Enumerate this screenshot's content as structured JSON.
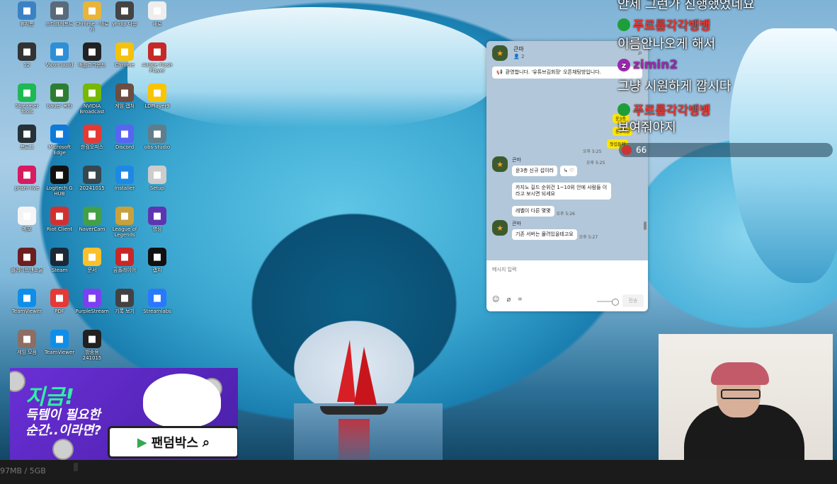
{
  "desktop": {
    "icons": [
      {
        "label": "휴지통",
        "icon": "recycle-bin-icon",
        "color": "#3b82c4"
      },
      {
        "label": "스타크래프트",
        "icon": "game-icon",
        "color": "#5a6a7a"
      },
      {
        "label": "Chrome - 바로가",
        "icon": "folder-icon",
        "color": "#e8b43a"
      },
      {
        "label": "yt-dlp 다운",
        "icon": "file-icon",
        "color": "#444"
      },
      {
        "label": "새로",
        "icon": "document-icon",
        "color": "#eee"
      },
      {
        "label": "12",
        "icon": "image-icon",
        "color": "#333"
      },
      {
        "label": "Vicon build",
        "icon": "app-icon",
        "color": "#2d8fd6"
      },
      {
        "label": "배틀그라운드",
        "icon": "pubg-icon",
        "color": "#222"
      },
      {
        "label": "Chrome",
        "icon": "chrome-icon",
        "color": "#f4c20d"
      },
      {
        "label": "Adobe Flash Player",
        "icon": "flash-icon",
        "color": "#c62828"
      },
      {
        "label": "Streamer Tools",
        "icon": "stream-icon",
        "color": "#1db954"
      },
      {
        "label": "bauer 녹화",
        "icon": "record-icon",
        "color": "#2e7d32"
      },
      {
        "label": "NVIDIA Broadcast",
        "icon": "nvidia-icon",
        "color": "#76b900"
      },
      {
        "label": "게임 캡처",
        "icon": "game-capture-icon",
        "color": "#6d4c41"
      },
      {
        "label": "LDPlayer9",
        "icon": "ldplayer-icon",
        "color": "#f9c400"
      },
      {
        "label": "프로그",
        "icon": "program-icon",
        "color": "#263238"
      },
      {
        "label": "Microsoft Edge",
        "icon": "edge-icon",
        "color": "#0f7bd8"
      },
      {
        "label": "한컴오피스",
        "icon": "hancom-icon",
        "color": "#e53935"
      },
      {
        "label": "Discord",
        "icon": "discord-icon",
        "color": "#5865f2"
      },
      {
        "label": "obs-studio",
        "icon": "obs-icon",
        "color": "#607d8b"
      },
      {
        "label": "prism live",
        "icon": "prism-icon",
        "color": "#d81b60"
      },
      {
        "label": "Logitech G HUB",
        "icon": "logitech-icon",
        "color": "#111"
      },
      {
        "label": "20241015",
        "icon": "video-icon",
        "color": "#37474f"
      },
      {
        "label": "Installer",
        "icon": "installer-icon",
        "color": "#1e88e5"
      },
      {
        "label": "Setup",
        "icon": "setup-icon",
        "color": "#ccc"
      },
      {
        "label": "메모",
        "icon": "memo-icon",
        "color": "#f5f5f5"
      },
      {
        "label": "Riot Client",
        "icon": "riot-icon",
        "color": "#d32f2f"
      },
      {
        "label": "NaverCam",
        "icon": "navercam-icon",
        "color": "#43a047"
      },
      {
        "label": "League of Legends",
        "icon": "lol-icon",
        "color": "#c8a13d"
      },
      {
        "label": "영상",
        "icon": "clip-icon",
        "color": "#5e35b1"
      },
      {
        "label": "블레이드앤소울",
        "icon": "bns-icon",
        "color": "#6d1f1f"
      },
      {
        "label": "Steam",
        "icon": "steam-icon",
        "color": "#1b2838"
      },
      {
        "label": "문서",
        "icon": "docs-icon",
        "color": "#fbc02d"
      },
      {
        "label": "곰플레이어",
        "icon": "gomplayer-icon",
        "color": "#c62828"
      },
      {
        "label": "캡처",
        "icon": "capture-icon",
        "color": "#111"
      },
      {
        "label": "TeamViewer",
        "icon": "teamviewer-icon",
        "color": "#0e8ee9"
      },
      {
        "label": "PDF",
        "icon": "pdf-icon",
        "color": "#e53935"
      },
      {
        "label": "PurpleStream",
        "icon": "purple-icon",
        "color": "#7e3ff2"
      },
      {
        "label": "기록 보기",
        "icon": "clock-icon",
        "color": "#424242"
      },
      {
        "label": "Streamlabs",
        "icon": "streamlabs-icon",
        "color": "#2979ff"
      },
      {
        "label": "게임 모음",
        "icon": "games-icon",
        "color": "#8d6e63"
      },
      {
        "label": "TeamViewer",
        "icon": "teamviewer-icon",
        "color": "#0e8ee9"
      },
      {
        "label": "방송용 241015",
        "icon": "film-icon",
        "color": "#212121"
      }
    ]
  },
  "chat_window": {
    "title": "큰마",
    "member_count": "👤 2",
    "notice": "환영합니다. '유튜브김회장' 오픈채팅방입니다.",
    "messages": [
      {
        "name": "큰마",
        "lines": [
          "윤3층 신규 섭이라"
        ],
        "time": "오후 5:25"
      },
      {
        "name": "",
        "lines": [
          "카지노 길드 순위건 1~10위 안에 사람들 이라고 보시면 되세요"
        ],
        "time": ""
      },
      {
        "name": "",
        "lines": [
          "레벨이 다른 몇몇"
        ],
        "time": "오후 5:26"
      },
      {
        "name": "큰마",
        "lines": [
          "기존 서버는 몰려있을테고요"
        ],
        "time": "오후 5:27"
      }
    ],
    "my_bubbles": [
      "윤3층",
      "윤3이랑",
      "첫섭들에"
    ],
    "my_time": "오후 5:25",
    "compose_placeholder": "메시지 입력",
    "send_label": "전송"
  },
  "stream_overlay": {
    "top_line": "안제 그런가 진행했었네요",
    "entries": [
      {
        "user": "푸르륨각각뱅뱅",
        "user_color": "#e53935",
        "dot_color": "#1e9e3a",
        "message": "이름안나오게 해서"
      },
      {
        "user": "zimin2",
        "user_color": "#9c27b0",
        "dot_color": "#9c27b0",
        "message": "그냥 시원하게 깝시다"
      },
      {
        "user": "푸르륨각각뱅뱅",
        "user_color": "#e53935",
        "dot_color": "#1e9e3a",
        "message": "보여줘야지"
      }
    ],
    "viewer_count": "66"
  },
  "ad": {
    "headline": "지금!",
    "subline1": "득템이 필요한",
    "subline2": "순간..이라면?",
    "button_label": "팬덤박스"
  },
  "status_bar": {
    "text": "97MB / 5GB"
  }
}
